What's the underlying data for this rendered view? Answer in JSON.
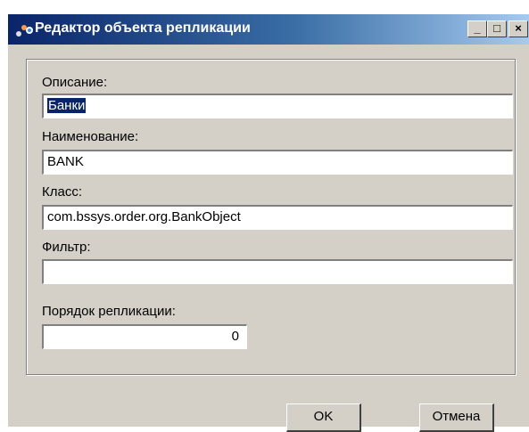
{
  "window": {
    "title": "Редактор объекта репликации",
    "controls": {
      "minimize": "_",
      "maximize": "□",
      "close": "×"
    }
  },
  "form": {
    "description_label": "Описание:",
    "description_value": "Банки",
    "name_label": "Наименование:",
    "name_value": "BANK",
    "class_label": "Класс:",
    "class_value": "com.bssys.order.org.BankObject",
    "filter_label": "Фильтр:",
    "filter_value": "",
    "order_label": "Порядок репликации:",
    "order_value": "0"
  },
  "buttons": {
    "ok": "OK",
    "cancel": "Отмена"
  },
  "colors": {
    "title_start": "#0a246a",
    "title_end": "#a6caf0",
    "face": "#d4d0c8",
    "selection": "#0a246a"
  }
}
